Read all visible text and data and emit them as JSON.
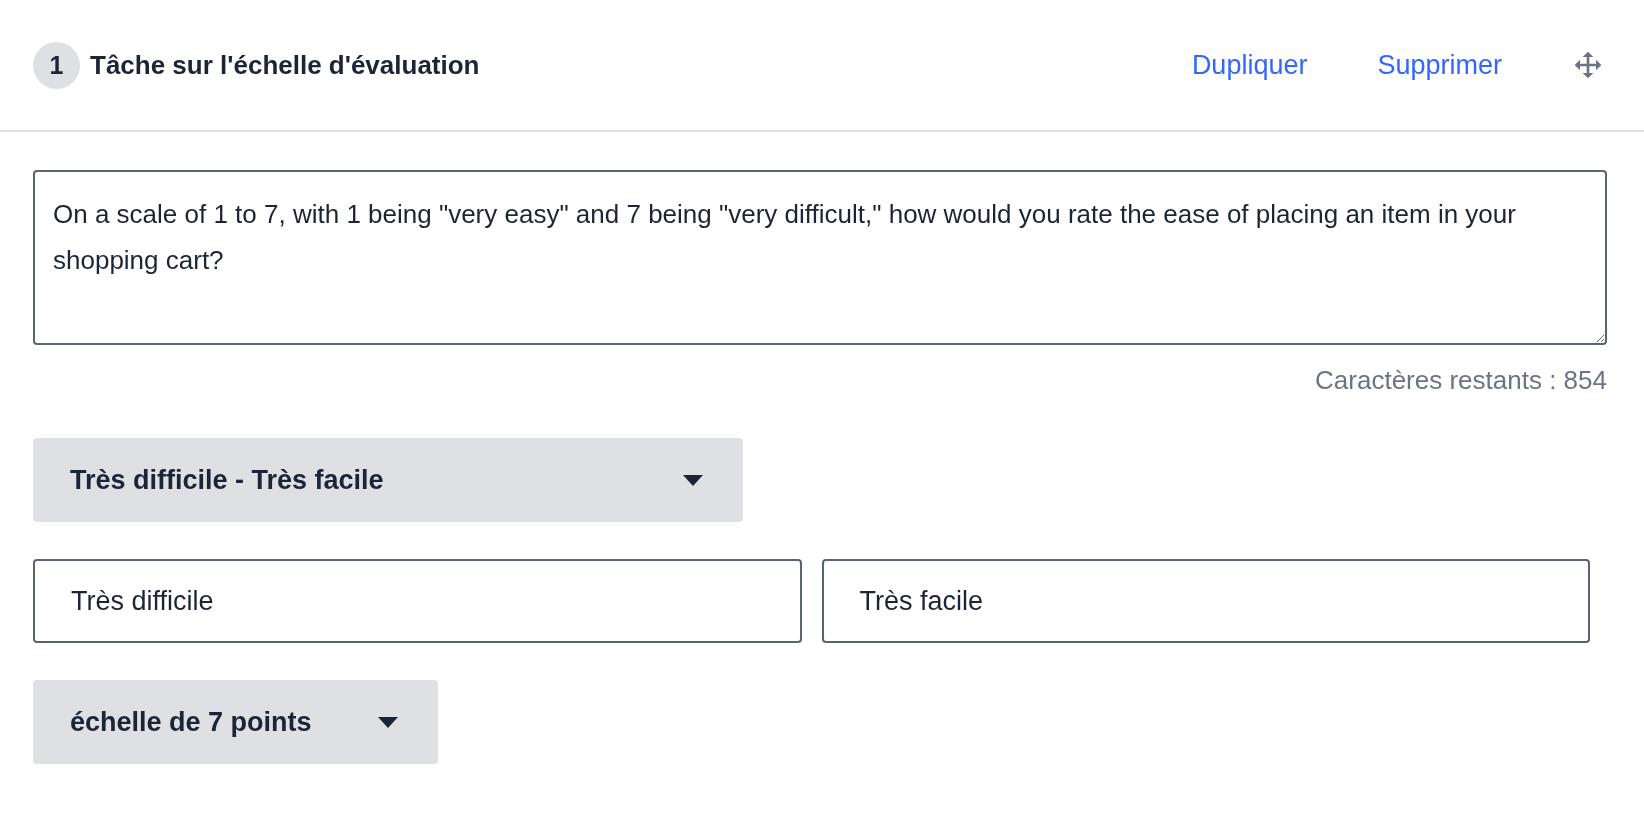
{
  "header": {
    "number": "1",
    "title": "Tâche sur l'échelle d'évaluation",
    "actions": [
      "Dupliquer",
      "Supprimer"
    ]
  },
  "question": {
    "value": "On a scale of 1 to 7, with 1 being \"very easy\" and 7 being \"very difficult,\" how would you rate the ease of placing an item in your shopping cart?"
  },
  "char_count": "Caractères restants : 854",
  "scale_type": {
    "value": "Très difficile - Très facile"
  },
  "labels": [
    {
      "value": "Très difficile"
    },
    {
      "value": "Très facile"
    }
  ],
  "points": {
    "value": "échelle de 7 points"
  }
}
